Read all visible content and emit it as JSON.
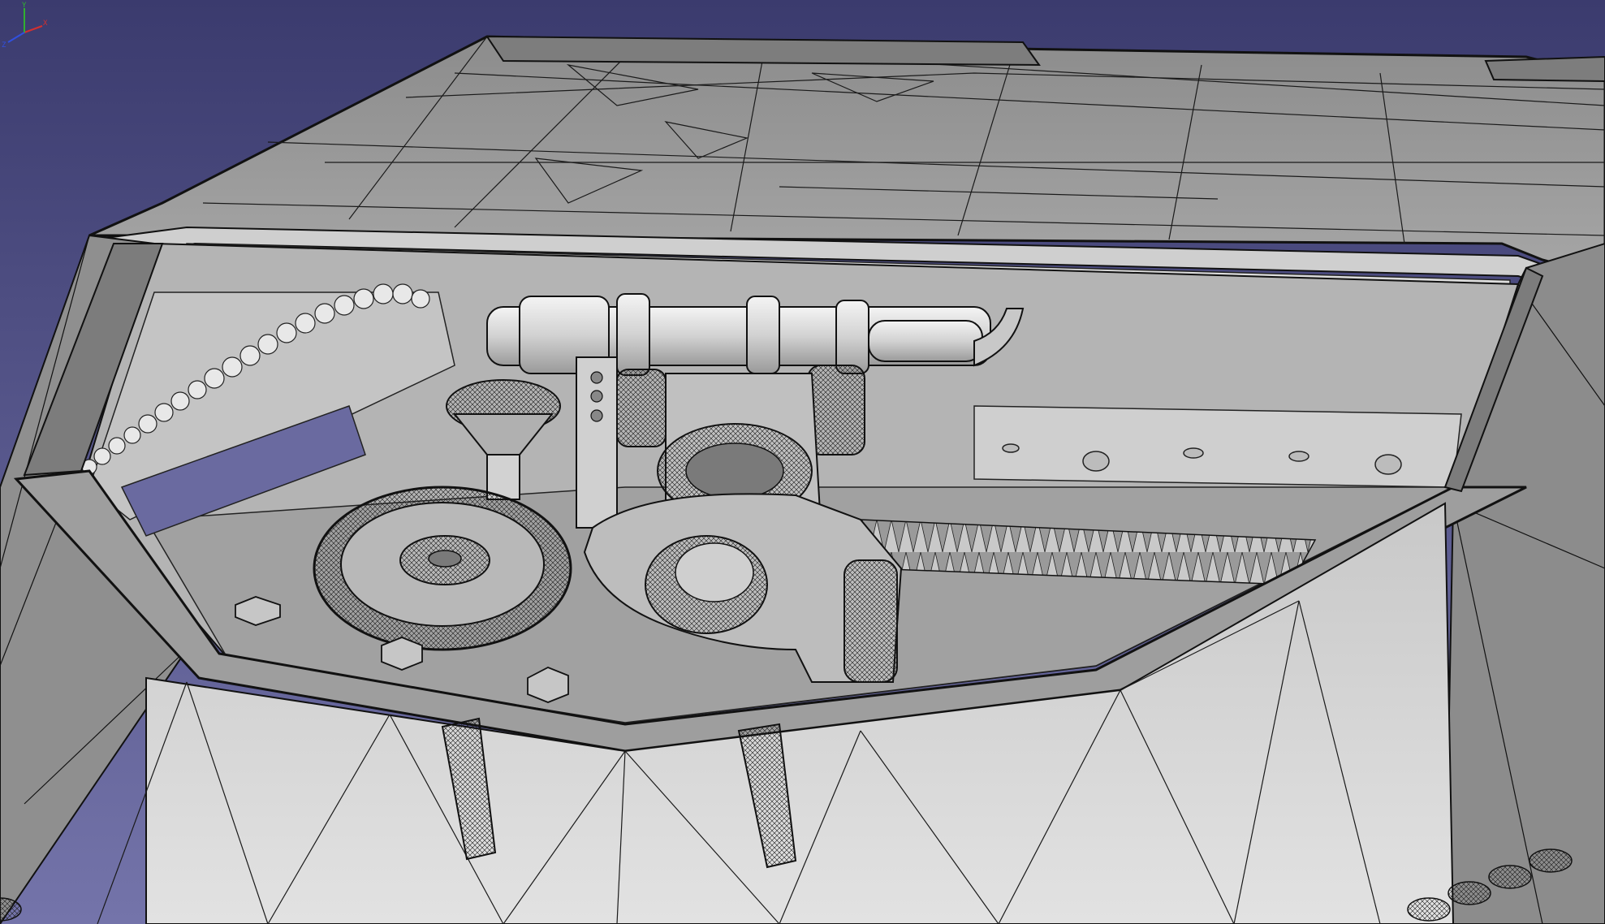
{
  "app": {
    "type": "3d-cad-viewport",
    "render_style": "shaded-with-wireframe-edges"
  },
  "colors": {
    "background_top": "#3b3b6e",
    "background_bottom": "#6e6ea6",
    "surface_light": "#d6d6d6",
    "surface_mid": "#a9a9a9",
    "surface_dark": "#6f6f6f",
    "edge": "#141414"
  },
  "axis_gizmo": {
    "x_label": "X",
    "y_label": "Y",
    "z_label": "Z",
    "x_color": "#d23030",
    "y_color": "#30b030",
    "z_color": "#3050e0"
  },
  "icons": [
    "axis-cross-icon"
  ]
}
